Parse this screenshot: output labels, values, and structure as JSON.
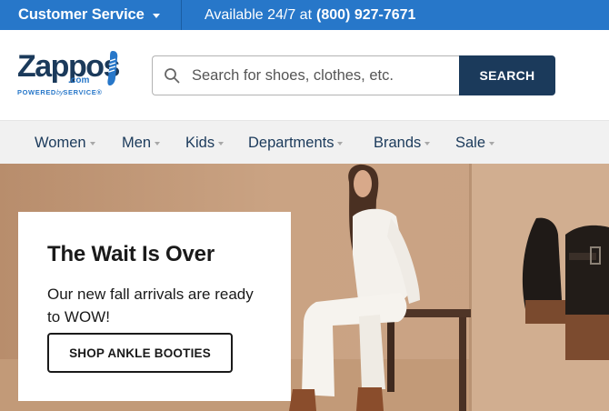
{
  "topbar": {
    "customer_service": "Customer Service",
    "availability": "Available 24/7 at",
    "phone": "(800) 927-7671"
  },
  "header": {
    "logo": {
      "name": "Zappos",
      "domain": ".com",
      "tagline_powered": "POWERED",
      "tagline_by": "by",
      "tagline_service": "SERVICE®"
    },
    "search": {
      "placeholder": "Search for shoes, clothes, etc.",
      "value": "",
      "button_label": "SEARCH"
    }
  },
  "nav": {
    "items": [
      {
        "label": "Women"
      },
      {
        "label": "Men"
      },
      {
        "label": "Kids"
      },
      {
        "label": "Departments"
      },
      {
        "label": "Brands"
      },
      {
        "label": "Sale"
      }
    ]
  },
  "hero": {
    "title": "The Wait Is Over",
    "subtitle": "Our new fall arrivals are ready to WOW!",
    "cta_label": "SHOP ANKLE BOOTIES"
  },
  "colors": {
    "topbar": "#2777c9",
    "brand_navy": "#1b3a5b",
    "nav_bg": "#f1f1f1",
    "hero_bg": "#c79f7e"
  },
  "icons": [
    "chevron-down-icon",
    "search-icon",
    "shoe-logo-icon"
  ]
}
